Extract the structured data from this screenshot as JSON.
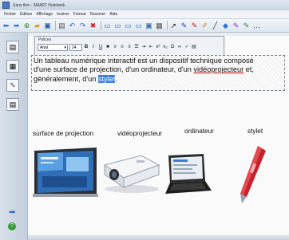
{
  "window": {
    "title": "Sans titre - SMART Notebook"
  },
  "menu": [
    "Fichier",
    "Édition",
    "Affichage",
    "Insérer",
    "Format",
    "Dessiner",
    "Aide"
  ],
  "fontbar": {
    "title": "Polices",
    "font_value": "Arial",
    "size_value": "24"
  },
  "paragraph": {
    "line1": "Un tableau numérique interactif est un dispositif technique composé",
    "line2_a": "d'une surface de projection, d'un ordinateur, d'un ",
    "line2_u": "vidéoprojecteur",
    "line2_b": " et,",
    "line3_a": "généralement, d'un ",
    "line3_sel": "stylet",
    "line3_b": "."
  },
  "labels": {
    "surface": "surface de projection",
    "videoprojecteur": "vidéoprojecteur",
    "ordinateur": "ordinateur",
    "stylet": "stylet"
  },
  "colors": {
    "selection": "#3b7ddd",
    "page": "#fafafa",
    "toolbar": "#e4ebf2"
  }
}
